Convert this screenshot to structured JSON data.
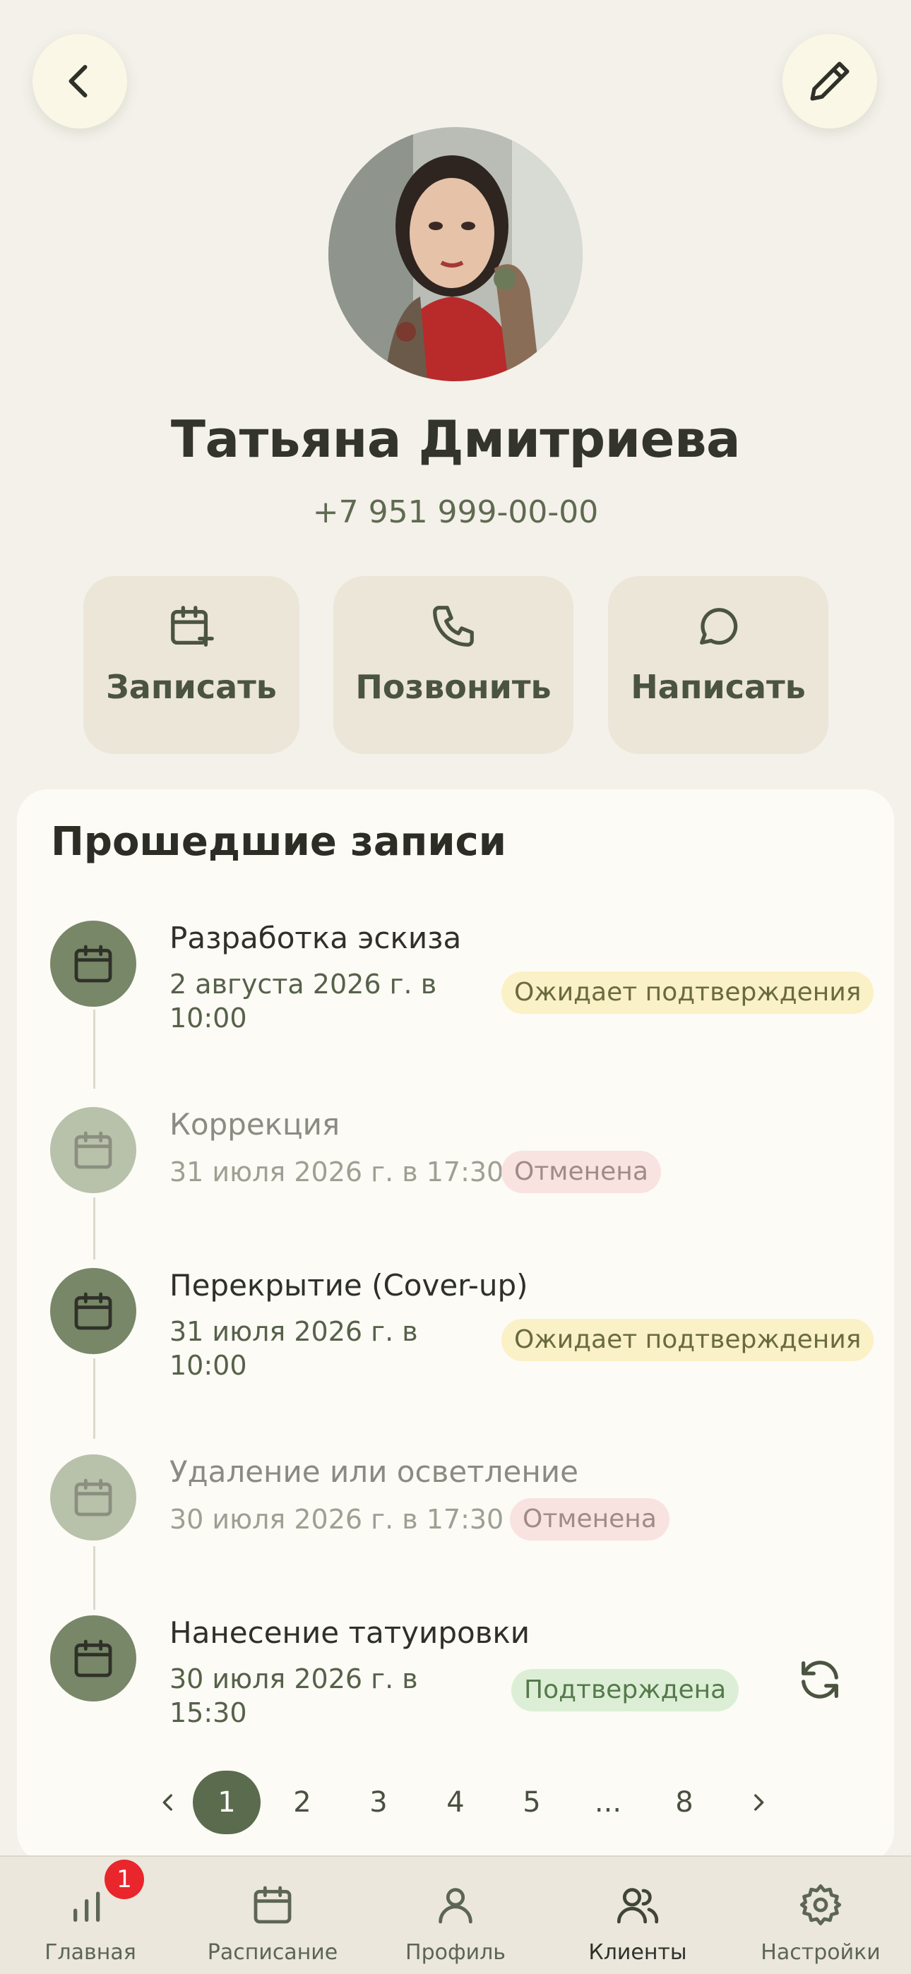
{
  "client": {
    "name": "Татьяна Дмитриева",
    "phone": "+7 951 999-00-00"
  },
  "actions": {
    "book": "Записать",
    "call": "Позвонить",
    "message": "Написать"
  },
  "history": {
    "title": "Прошедшие записи",
    "items": [
      {
        "title": "Разработка эскиза",
        "date": "2 августа 2026 г. в 10:00",
        "status": "Ожидает подтверждения"
      },
      {
        "title": "Коррекция",
        "date": "31 июля 2026 г. в 17:30",
        "status": "Отменена"
      },
      {
        "title": "Перекрытие (Cover-up)",
        "date": "31 июля 2026 г. в 10:00",
        "status": "Ожидает подтверждения"
      },
      {
        "title": "Удаление или осветление",
        "date": "30 июля 2026 г. в 17:30",
        "status": "Отменена"
      },
      {
        "title": "Нанесение татуировки",
        "date": "30 июля 2026 г. в 15:30",
        "status": "Подтверждена"
      }
    ]
  },
  "pagination": {
    "pages": [
      "1",
      "2",
      "3",
      "4",
      "5",
      "...",
      "8"
    ],
    "current": "1"
  },
  "tabbar": {
    "home": "Главная",
    "schedule": "Расписание",
    "profile": "Профиль",
    "clients": "Клиенты",
    "settings": "Настройки",
    "home_badge": "1"
  },
  "colors": {
    "accent": "#5b6b4e",
    "status_wait_bg": "#faf1c6",
    "status_cancel_bg": "#f8e3e1",
    "status_ok_bg": "#dcefd6",
    "badge_red": "#e8262b"
  }
}
